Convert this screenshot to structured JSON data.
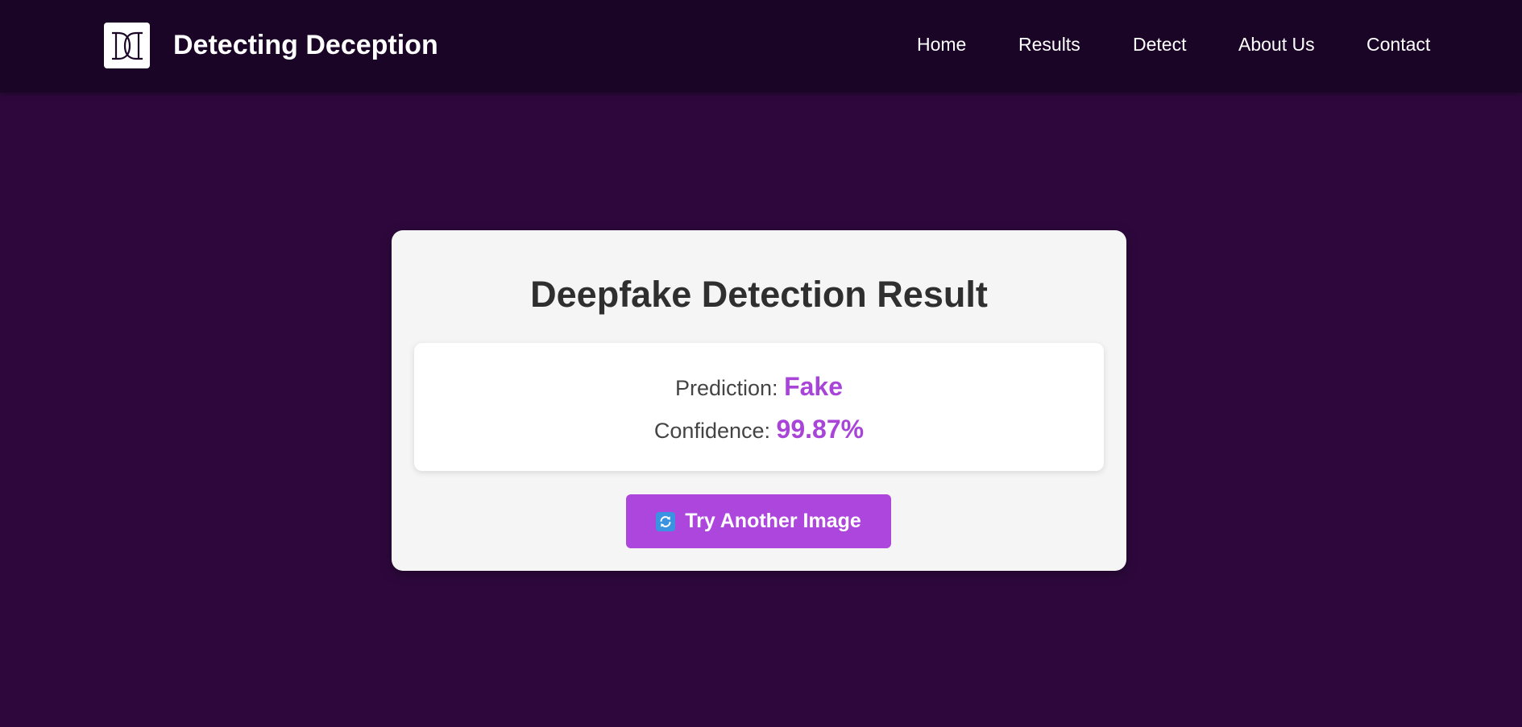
{
  "app": {
    "brand": "Detecting Deception",
    "logo_icon": "dd-monogram-logo"
  },
  "nav": {
    "items": [
      {
        "label": "Home"
      },
      {
        "label": "Results"
      },
      {
        "label": "Detect"
      },
      {
        "label": "About Us"
      },
      {
        "label": "Contact"
      }
    ]
  },
  "result": {
    "title": "Deepfake Detection Result",
    "prediction_label": "Prediction:",
    "prediction_value": "Fake",
    "confidence_label": "Confidence:",
    "confidence_value": "99.87%",
    "retry_label": "Try Another Image",
    "retry_icon": "refresh-icon"
  },
  "colors": {
    "page_background": "#2e083d",
    "header_background": "#1a0526",
    "accent": "#ad46dc",
    "result_value": "#a845d8",
    "card_background": "#f5f5f5"
  }
}
